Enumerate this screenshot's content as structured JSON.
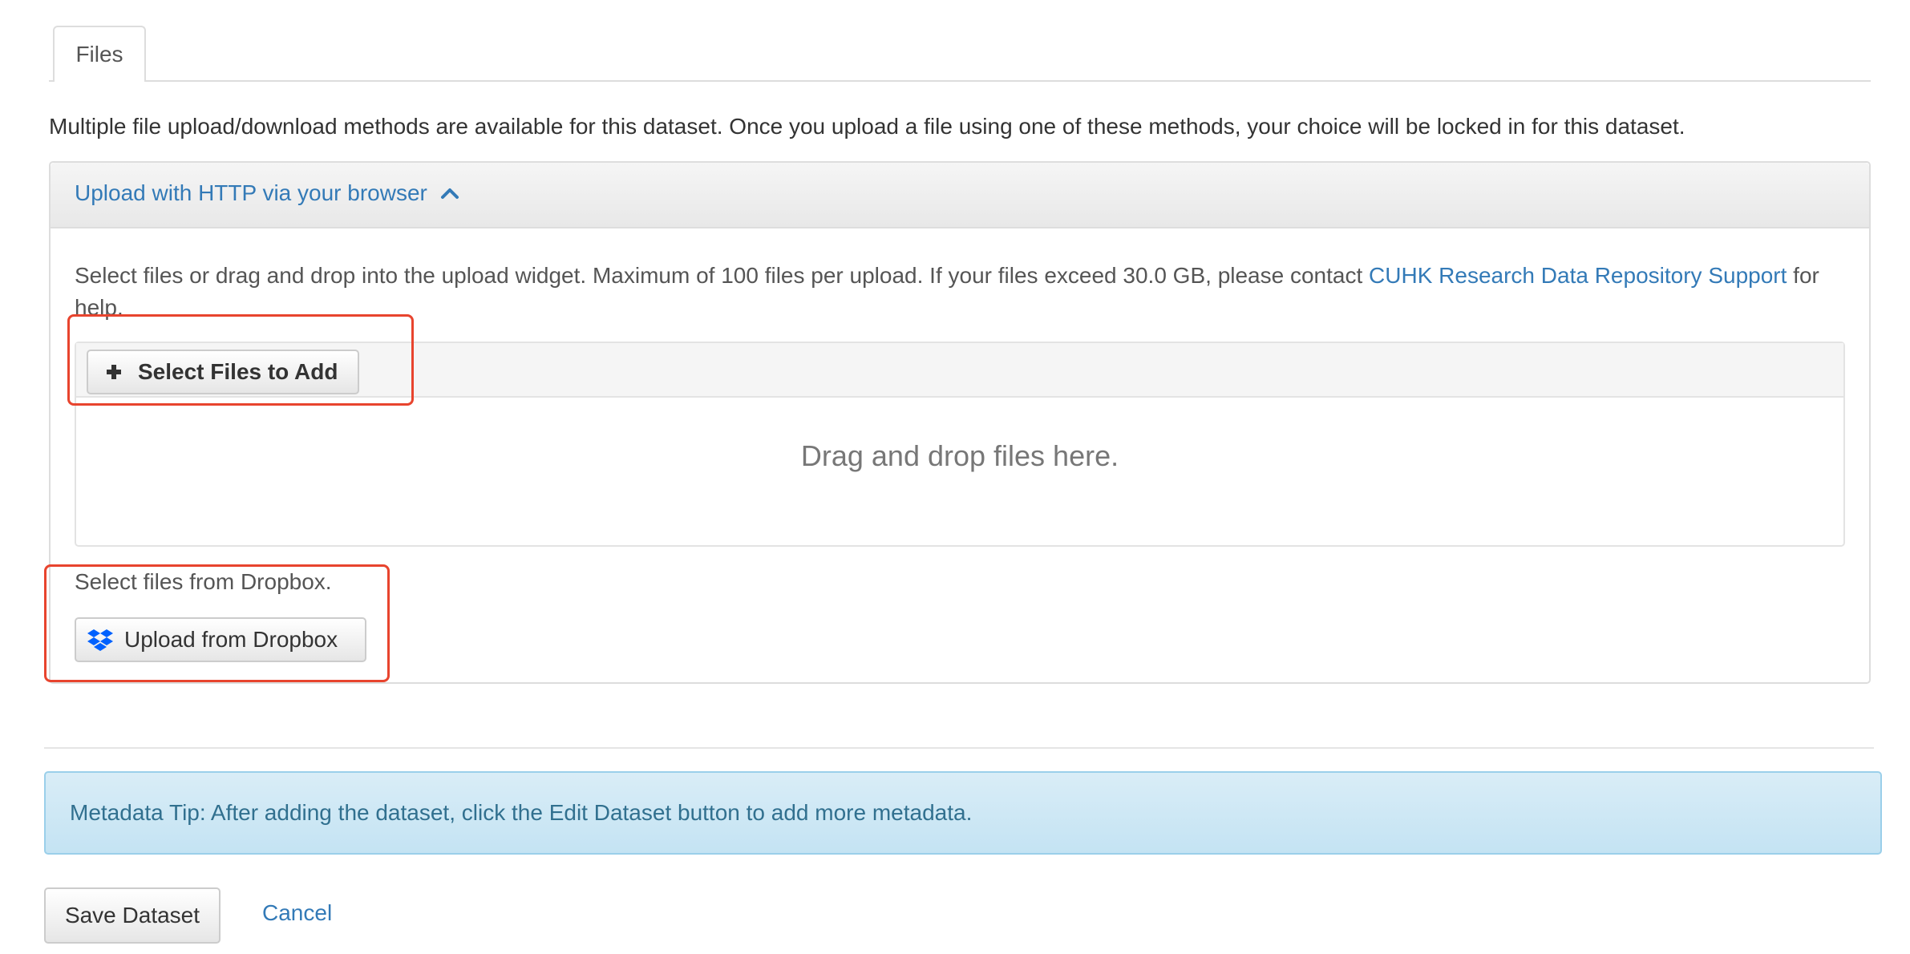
{
  "tabs": [
    {
      "label": "Files"
    }
  ],
  "intro_text": "Multiple file upload/download methods are available for this dataset. Once you upload a file using one of these methods, your choice will be locked in for this dataset.",
  "http_panel": {
    "heading": "Upload with HTTP via your browser",
    "help_text_before": "Select files or drag and drop into the upload widget. Maximum of 100 files per upload. If your files exceed 30.0 GB, please contact ",
    "help_link": "CUHK Research Data Repository Support",
    "help_text_after": " for help.",
    "select_button": "Select Files to Add",
    "drop_text": "Drag and drop files here.",
    "dropbox_label": "Select files from Dropbox.",
    "dropbox_button": "Upload from Dropbox"
  },
  "alert": {
    "text": "Metadata Tip: After adding the dataset, click the Edit Dataset button to add more metadata."
  },
  "actions": {
    "save_label": "Save Dataset",
    "cancel_label": "Cancel"
  },
  "colors": {
    "link": "#337ab7",
    "highlight": "#e8442e",
    "alert_bg": "#d9edf7",
    "alert_text": "#31708f",
    "dropbox": "#0061fe"
  },
  "icons": {
    "chevron": "chevron-up-icon",
    "plus": "plus-icon",
    "dropbox": "dropbox-icon"
  }
}
